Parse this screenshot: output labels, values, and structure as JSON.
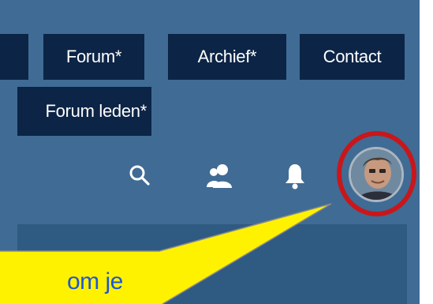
{
  "nav": {
    "forum": "Forum*",
    "archief": "Archief*",
    "contact": "Contact",
    "forum_leden": "Forum leden*"
  },
  "toolbar": {
    "icons": [
      "search-icon",
      "users-icon",
      "bell-icon",
      "avatar"
    ]
  },
  "callout": {
    "text": "om je"
  },
  "colors": {
    "background": "#406b94",
    "nav_button": "#0c2446",
    "highlight_ring": "#c8171b",
    "callout_fill": "#fff200",
    "callout_text": "#1e57d6",
    "panel": "#2f5a82"
  }
}
